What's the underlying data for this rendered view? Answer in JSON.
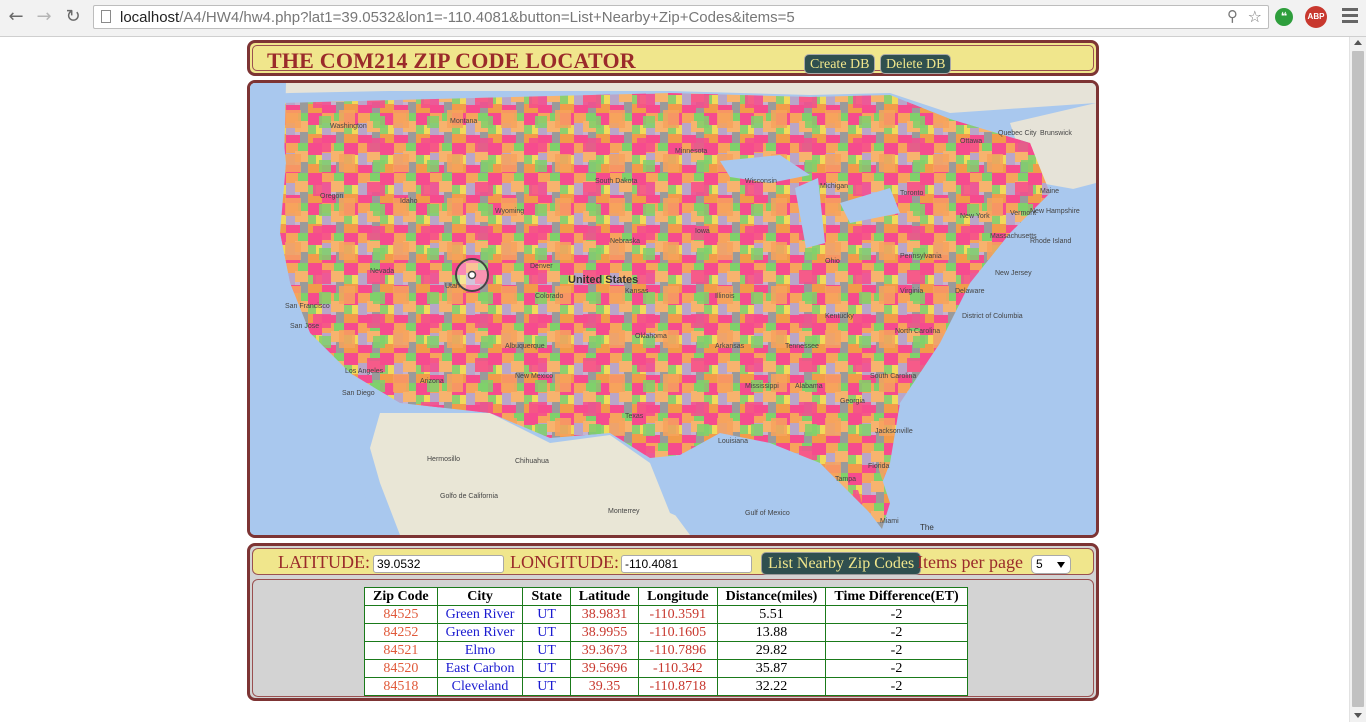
{
  "browser": {
    "url_host": "localhost",
    "url_path": "/A4/HW4/hw4.php?lat1=39.0532&lon1=-110.4081&button=List+Nearby+Zip+Codes&items=5",
    "ext_abp_label": "ABP"
  },
  "header": {
    "title": "THE COM214 ZIP CODE LOCATOR",
    "create_label": "Create DB",
    "delete_label": "Delete DB"
  },
  "map": {
    "country_label": "United States",
    "footer_label": "The",
    "place_labels": [
      "Washington",
      "Montana",
      "Minnesota",
      "South Dakota",
      "Oregon",
      "Idaho",
      "Wyoming",
      "Wisconsin",
      "Michigan",
      "Nevada",
      "Utah",
      "Colorado",
      "Denver",
      "Nebraska",
      "Kansas",
      "Iowa",
      "Illinois",
      "Ohio",
      "Pennsylvania",
      "New York",
      "Toronto",
      "Quebec City",
      "Maine",
      "Vermont",
      "New Hampshire",
      "Massachusetts",
      "Rhode Island",
      "New Jersey",
      "Delaware",
      "District of Columbia",
      "San Francisco",
      "San Jose",
      "Los Angeles",
      "San Diego",
      "Arizona",
      "New Mexico",
      "Albuquerque",
      "Texas",
      "Oklahoma",
      "Arkansas",
      "Mississippi",
      "Alabama",
      "Georgia",
      "Tennessee",
      "Kentucky",
      "North Carolina",
      "South Carolina",
      "Virginia",
      "Louisiana",
      "Florida",
      "Jacksonville",
      "Tampa",
      "Miami",
      "Hermosillo",
      "Chihuahua",
      "Monterrey",
      "Gulf of Mexico",
      "Golfo de California",
      "Brunswick",
      "Ottawa"
    ]
  },
  "form": {
    "lat_label": "LATITUDE:",
    "lat_value": "39.0532",
    "lon_label": "LONGITUDE:",
    "lon_value": "-110.4081",
    "list_button": "List Nearby Zip Codes",
    "items_label": "Items per page",
    "items_value": "5"
  },
  "table": {
    "headers": [
      "Zip Code",
      "City",
      "State",
      "Latitude",
      "Longitude",
      "Distance(miles)",
      "Time Difference(ET)"
    ],
    "rows": [
      [
        "84525",
        "Green River",
        "UT",
        "38.9831",
        "-110.3591",
        "5.51",
        "-2"
      ],
      [
        "84252",
        "Green River",
        "UT",
        "38.9955",
        "-110.1605",
        "13.88",
        "-2"
      ],
      [
        "84521",
        "Elmo",
        "UT",
        "39.3673",
        "-110.7896",
        "29.82",
        "-2"
      ],
      [
        "84520",
        "East Carbon",
        "UT",
        "39.5696",
        "-110.342",
        "35.87",
        "-2"
      ],
      [
        "84518",
        "Cleveland",
        "UT",
        "39.35",
        "-110.8718",
        "32.22",
        "-2"
      ]
    ]
  }
}
